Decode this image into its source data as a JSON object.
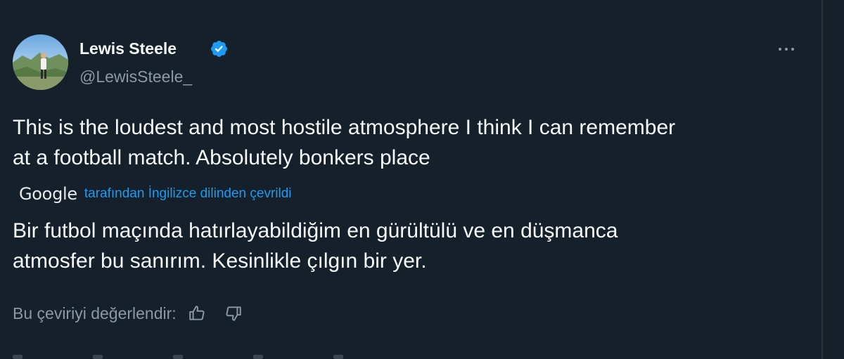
{
  "author": {
    "display_name": "Lewis Steele",
    "handle": "@LewisSteele_",
    "verified": true
  },
  "icons": {
    "verified": "verified-badge-icon",
    "more": "more-horizontal-icon",
    "thumbs_up": "thumbs-up-icon",
    "thumbs_down": "thumbs-down-icon"
  },
  "tweet": {
    "lines": [
      "This is the loudest and most hostile atmosphere I think I can remember",
      "at a football match. Absolutely bonkers place"
    ]
  },
  "translation": {
    "provider_logo": "Google",
    "attribution": "tarafından İngilizce dilinden çevrildi",
    "lines": [
      "Bir futbol maçında hatırlayabildiğim en gürültülü ve en düşmanca",
      "atmosfer bu sanırım. Kesinlikle çılgın bir yer."
    ],
    "rate_label": "Bu çeviriyi değerlendir:"
  },
  "colors": {
    "background": "#15202b",
    "text_primary": "#f7f9f9",
    "text_secondary": "#8b98a5",
    "accent": "#1d9bf0"
  }
}
